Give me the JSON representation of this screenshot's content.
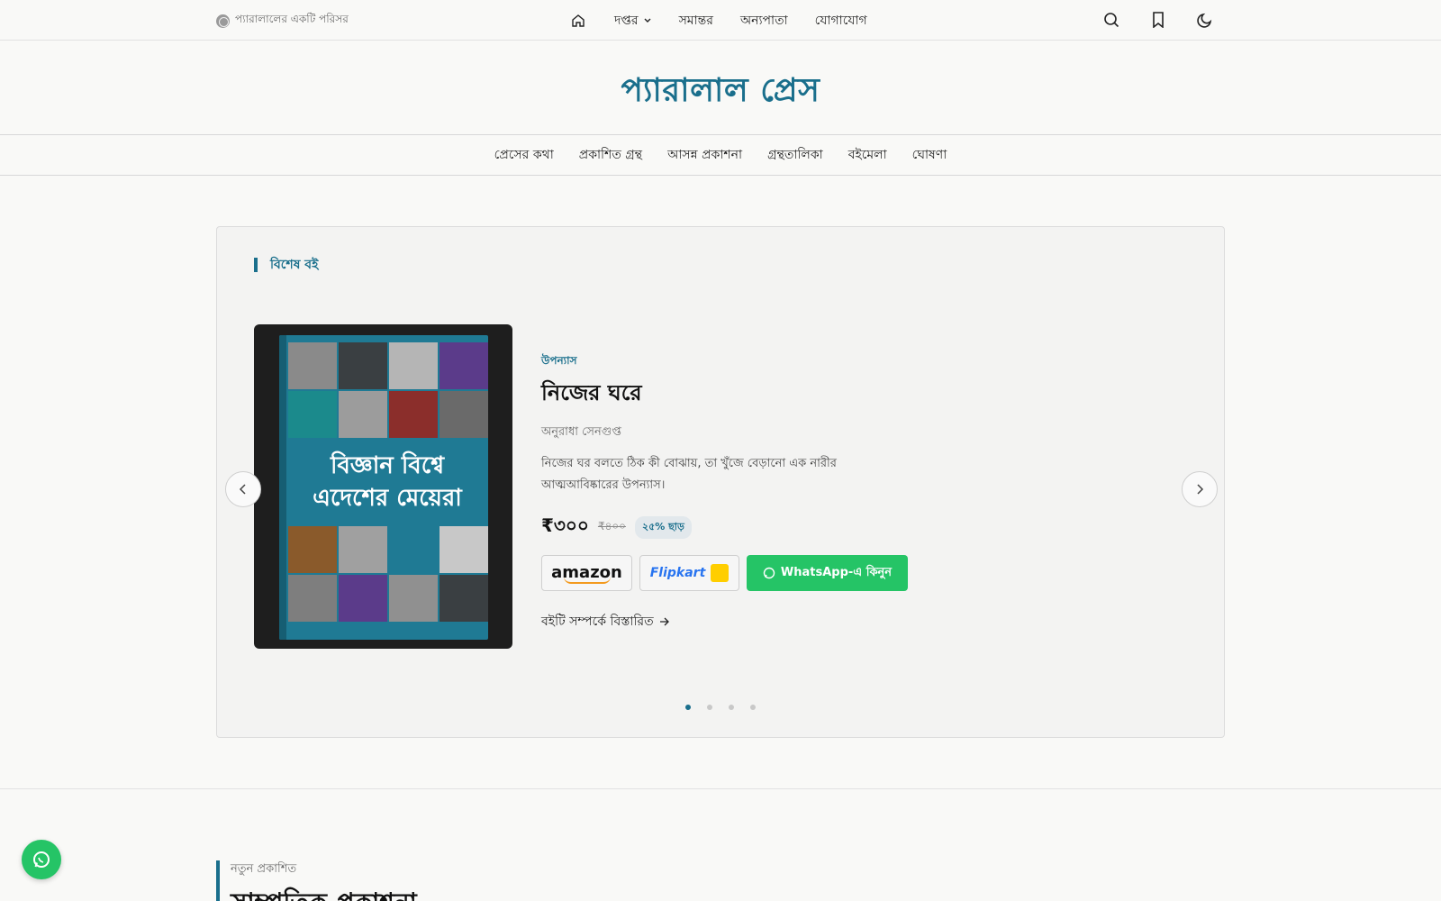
{
  "topbar": {
    "tagline": "প্যারালালের একটি পরিসর",
    "nav": {
      "home_icon": "home-icon",
      "items": [
        "দপ্তর",
        "সমান্তর",
        "অন্যপাতা",
        "যোগাযোগ"
      ]
    },
    "icons": [
      "search-icon",
      "bookmark-icon",
      "moon-icon"
    ]
  },
  "masthead": {
    "title": "প্যারালাল প্রেস"
  },
  "mainnav": {
    "items": [
      "প্রেসের কথা",
      "প্রকাশিত গ্রন্থ",
      "আসন্ন প্রকাশনা",
      "গ্রন্থতালিকা",
      "বইমেলা",
      "ঘোষণা"
    ]
  },
  "featured": {
    "section_label": "বিশেষ বই",
    "cover_title_line1": "বিজ্ঞান বিশ্বে",
    "cover_title_line2": "এদেশের মেয়েরা",
    "genre": "উপন্যাস",
    "title": "নিজের ঘরে",
    "author": "অনুরাধা সেনগুপ্ত",
    "description": "নিজের ঘর বলতে ঠিক কী বোঝায়, তা খুঁজে বেড়ানো এক নারীর আত্মআবিষ্কারের উপন্যাস।",
    "price": "₹৩০০",
    "old_price": "₹৪০০",
    "discount": "২৫% ছাড়",
    "amazon_label": "amazon",
    "flipkart_label": "Flipkart",
    "whatsapp_label": "WhatsApp-এ কিনুন",
    "more_label": "বইটি সম্পর্কে বিস্তারিত",
    "slides_total": 4,
    "active_slide": 1
  },
  "recent": {
    "eyebrow": "নতুন প্রকাশিত",
    "heading": "সাম্প্রতিক প্রকাশনা"
  },
  "colors": {
    "accent": "#1a6f8c",
    "whatsapp": "#25c466"
  }
}
